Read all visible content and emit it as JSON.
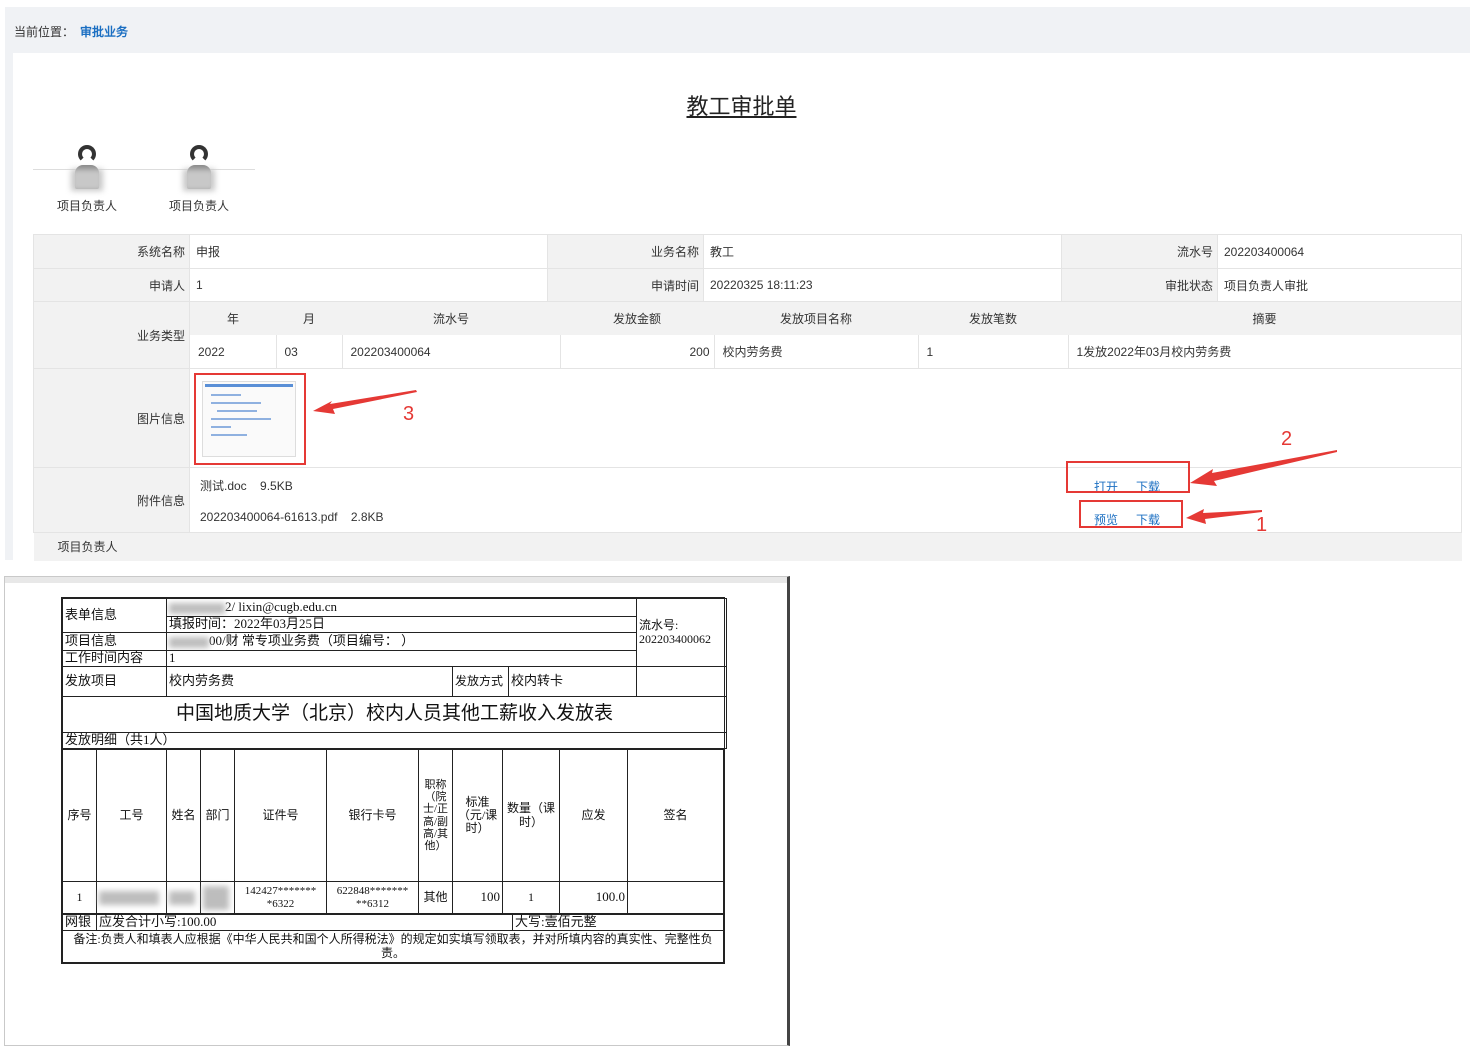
{
  "breadcrumb": {
    "prefix": "当前位置：",
    "current": "审批业务"
  },
  "title": "教工审批单",
  "approvers": [
    {
      "label": "项目负责人"
    },
    {
      "label": "项目负责人"
    }
  ],
  "info": {
    "system_name_label": "系统名称",
    "system_name": "申报",
    "business_name_label": "业务名称",
    "business_name": "教工",
    "serial_label": "流水号",
    "serial": "202203400064",
    "applicant_label": "申请人",
    "applicant": "1",
    "apply_time_label": "申请时间",
    "apply_time": "20220325 18:11:23",
    "status_label": "审批状态",
    "status": "项目负责人审批",
    "business_type_label": "业务类型",
    "biz_headers": [
      "年",
      "月",
      "流水号",
      "发放金额",
      "发放项目名称",
      "发放笔数",
      "摘要"
    ],
    "biz_row": [
      "2022",
      "03",
      "202203400064",
      "200",
      "校内劳务费",
      "1",
      "1发放2022年03月校内劳务费"
    ],
    "image_label": "图片信息",
    "attachment_label": "附件信息",
    "attachments": [
      {
        "name": "测试.doc",
        "size": "9.5KB",
        "action1": "打开",
        "action2": "下载"
      },
      {
        "name": "202203400064-61613.pdf",
        "size": "2.8KB",
        "action1": "预览",
        "action2": "下载"
      }
    ],
    "footer_label": "项目负责人"
  },
  "annotations": {
    "n1": "1",
    "n2": "2",
    "n3": "3",
    "color": "#e53935"
  },
  "form": {
    "info_label": "表单信息",
    "info_line1": "2/                lixin@cugb.edu.cn",
    "fill_time": "填报时间：2022年03月25日",
    "project_label": "项目信息",
    "project_value": "00/财             常专项业务费（项目编号：              ）",
    "serial_label": "流水号:",
    "serial_value": "202203400062",
    "work_label": "工作时间内容",
    "work_value": "1",
    "item_label": "发放项目",
    "item_value": "校内劳务费",
    "method_label": "发放方式",
    "method_value": "校内转卡",
    "big_title": "中国地质大学（北京）校内人员其他工薪收入发放表",
    "detail_label": "发放明细（共1人）",
    "headers": [
      "序号",
      "工号",
      "姓名",
      "部门",
      "证件号",
      "银行卡号",
      "职称（院士/正高/副高/其他）",
      "标准（元/课时）",
      "数量（课时）",
      "应发",
      "签名"
    ],
    "row": {
      "no": "1",
      "id_no": "142427*******\n*6322",
      "card": "622848*******\n**6312",
      "title": "其他",
      "std": "100",
      "qty": "1",
      "pay": "100.0"
    },
    "sum_label": "网银",
    "sum_small": "应发合计小写:100.00",
    "sum_big": "大写:壹佰元整",
    "note": "备注:负责人和填表人应根据《中华人民共和国个人所得税法》的规定如实填写领取表，并对所填内容的真实性、完整性负责。"
  }
}
